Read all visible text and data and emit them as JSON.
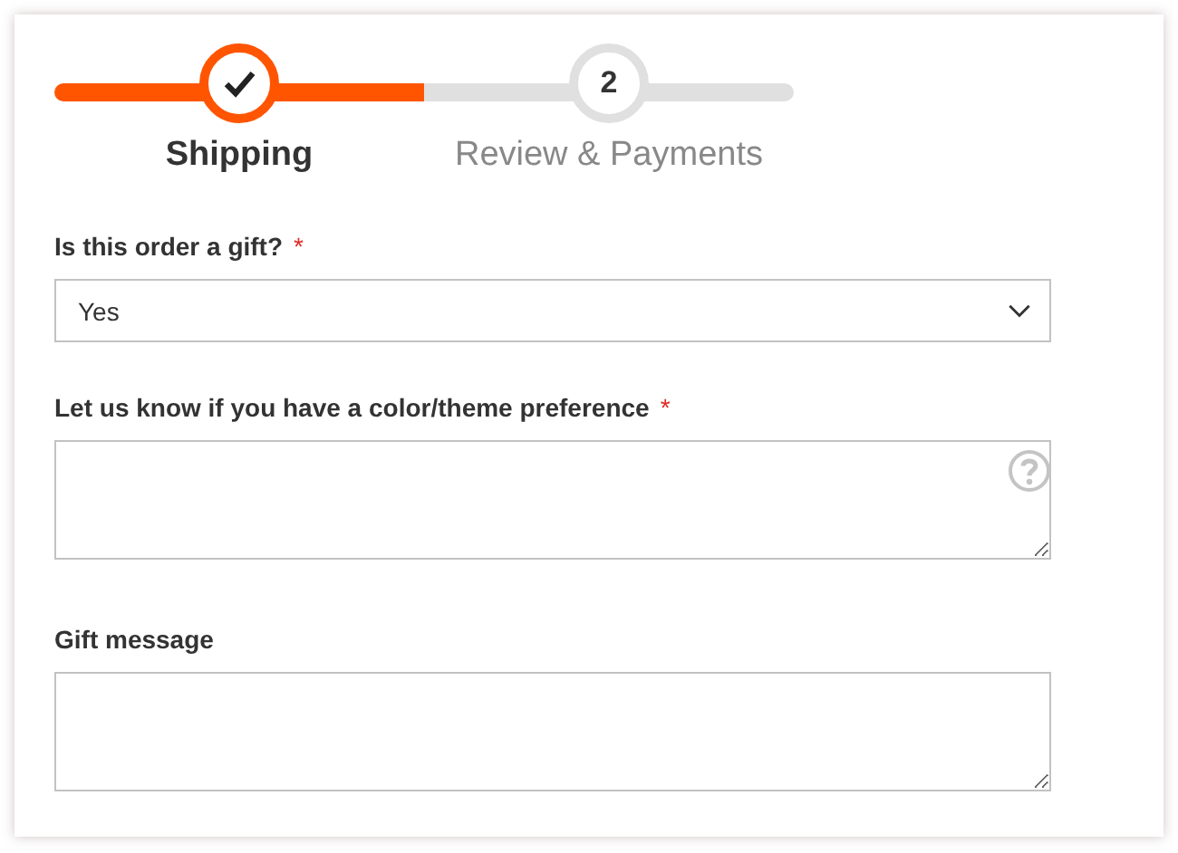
{
  "progress": {
    "steps": [
      {
        "label": "Shipping",
        "completed": true
      },
      {
        "label": "Review & Payments",
        "number": "2",
        "completed": false
      }
    ]
  },
  "fields": [
    {
      "kind": "select",
      "label": "Is this order a gift?",
      "required_mark": "*",
      "value": "Yes"
    },
    {
      "kind": "textarea",
      "label": "Let us know if you have a color/theme preference",
      "required_mark": "*",
      "help": true
    },
    {
      "kind": "textarea",
      "label": "Gift message"
    }
  ]
}
